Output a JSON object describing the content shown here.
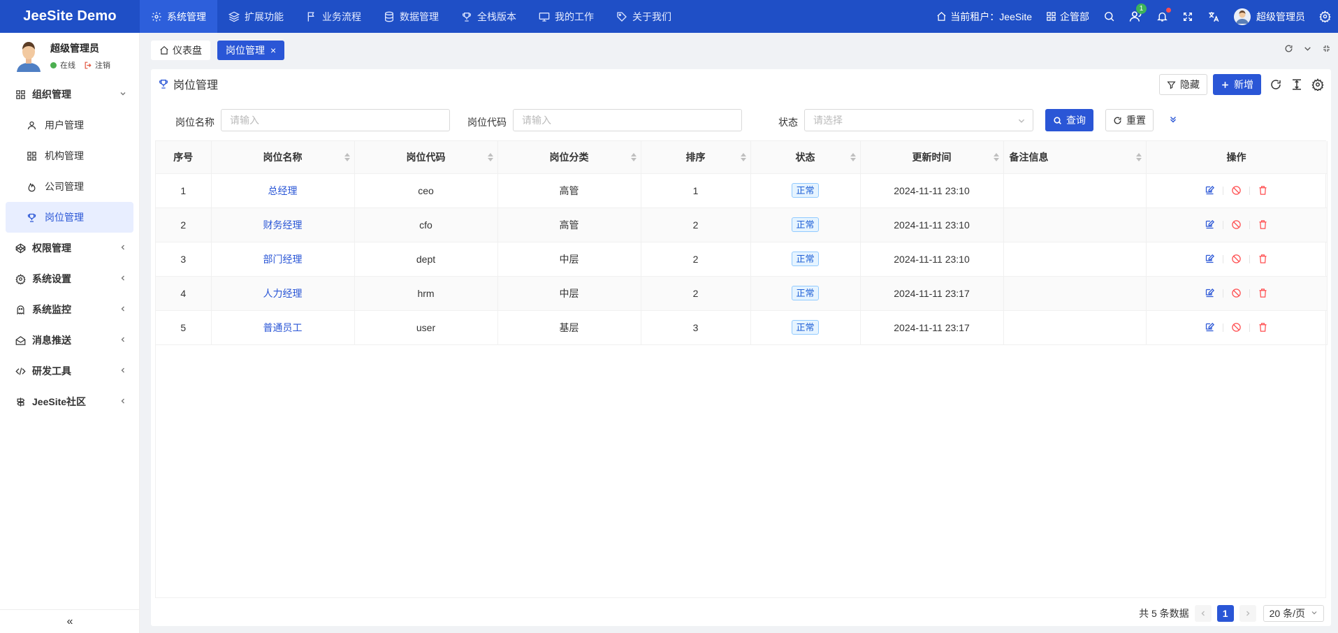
{
  "app": {
    "title": "JeeSite Demo"
  },
  "topnav": [
    {
      "label": "系统管理",
      "icon": "gear-icon",
      "active": true
    },
    {
      "label": "扩展功能",
      "icon": "layers-icon"
    },
    {
      "label": "业务流程",
      "icon": "flag-icon"
    },
    {
      "label": "数据管理",
      "icon": "database-icon"
    },
    {
      "label": "全栈版本",
      "icon": "trophy-icon"
    },
    {
      "label": "我的工作",
      "icon": "monitor-icon"
    },
    {
      "label": "关于我们",
      "icon": "tag-icon"
    }
  ],
  "header_right": {
    "tenant": "当前租户：JeeSite",
    "org": "企管部",
    "online_badge": "1",
    "username": "超级管理员"
  },
  "sidebar": {
    "user_name": "超级管理员",
    "status": "在线",
    "logout": "注销",
    "groups": [
      {
        "label": "组织管理",
        "expanded": true,
        "children": [
          {
            "label": "用户管理",
            "icon": "user-icon"
          },
          {
            "label": "机构管理",
            "icon": "grid-icon"
          },
          {
            "label": "公司管理",
            "icon": "fire-icon"
          },
          {
            "label": "岗位管理",
            "icon": "trophy-icon",
            "active": true
          }
        ]
      },
      {
        "label": "权限管理",
        "icon": "codepen-icon"
      },
      {
        "label": "系统设置",
        "icon": "gear-icon"
      },
      {
        "label": "系统监控",
        "icon": "ghost-icon"
      },
      {
        "label": "消息推送",
        "icon": "mail-icon"
      },
      {
        "label": "研发工具",
        "icon": "code-icon"
      },
      {
        "label": "JeeSite社区",
        "icon": "signpost-icon"
      }
    ],
    "collapse": "«"
  },
  "tabs": [
    {
      "label": "仪表盘",
      "icon": "home-icon"
    },
    {
      "label": "岗位管理",
      "active": true,
      "close": "×"
    }
  ],
  "page": {
    "title": "岗位管理",
    "btn_hide": "隐藏",
    "btn_add": "新增"
  },
  "search": {
    "name_label": "岗位名称",
    "name_placeholder": "请输入",
    "code_label": "岗位代码",
    "code_placeholder": "请输入",
    "status_label": "状态",
    "status_placeholder": "请选择",
    "query": "查询",
    "reset": "重置"
  },
  "table": {
    "columns": [
      "序号",
      "岗位名称",
      "岗位代码",
      "岗位分类",
      "排序",
      "状态",
      "更新时间",
      "备注信息",
      "操作"
    ],
    "rows": [
      {
        "no": "1",
        "name": "总经理",
        "code": "ceo",
        "category": "高管",
        "sort": "1",
        "status": "正常",
        "updated": "2024-11-11 23:10",
        "remark": ""
      },
      {
        "no": "2",
        "name": "财务经理",
        "code": "cfo",
        "category": "高管",
        "sort": "2",
        "status": "正常",
        "updated": "2024-11-11 23:10",
        "remark": ""
      },
      {
        "no": "3",
        "name": "部门经理",
        "code": "dept",
        "category": "中层",
        "sort": "2",
        "status": "正常",
        "updated": "2024-11-11 23:10",
        "remark": ""
      },
      {
        "no": "4",
        "name": "人力经理",
        "code": "hrm",
        "category": "中层",
        "sort": "2",
        "status": "正常",
        "updated": "2024-11-11 23:17",
        "remark": ""
      },
      {
        "no": "5",
        "name": "普通员工",
        "code": "user",
        "category": "基层",
        "sort": "3",
        "status": "正常",
        "updated": "2024-11-11 23:17",
        "remark": ""
      }
    ]
  },
  "pager": {
    "total": "共 5 条数据",
    "current": "1",
    "size": "20 条/页"
  },
  "colors": {
    "primary": "#2a56d6",
    "header": "#1f4fc6",
    "danger": "#ff4d4f"
  }
}
